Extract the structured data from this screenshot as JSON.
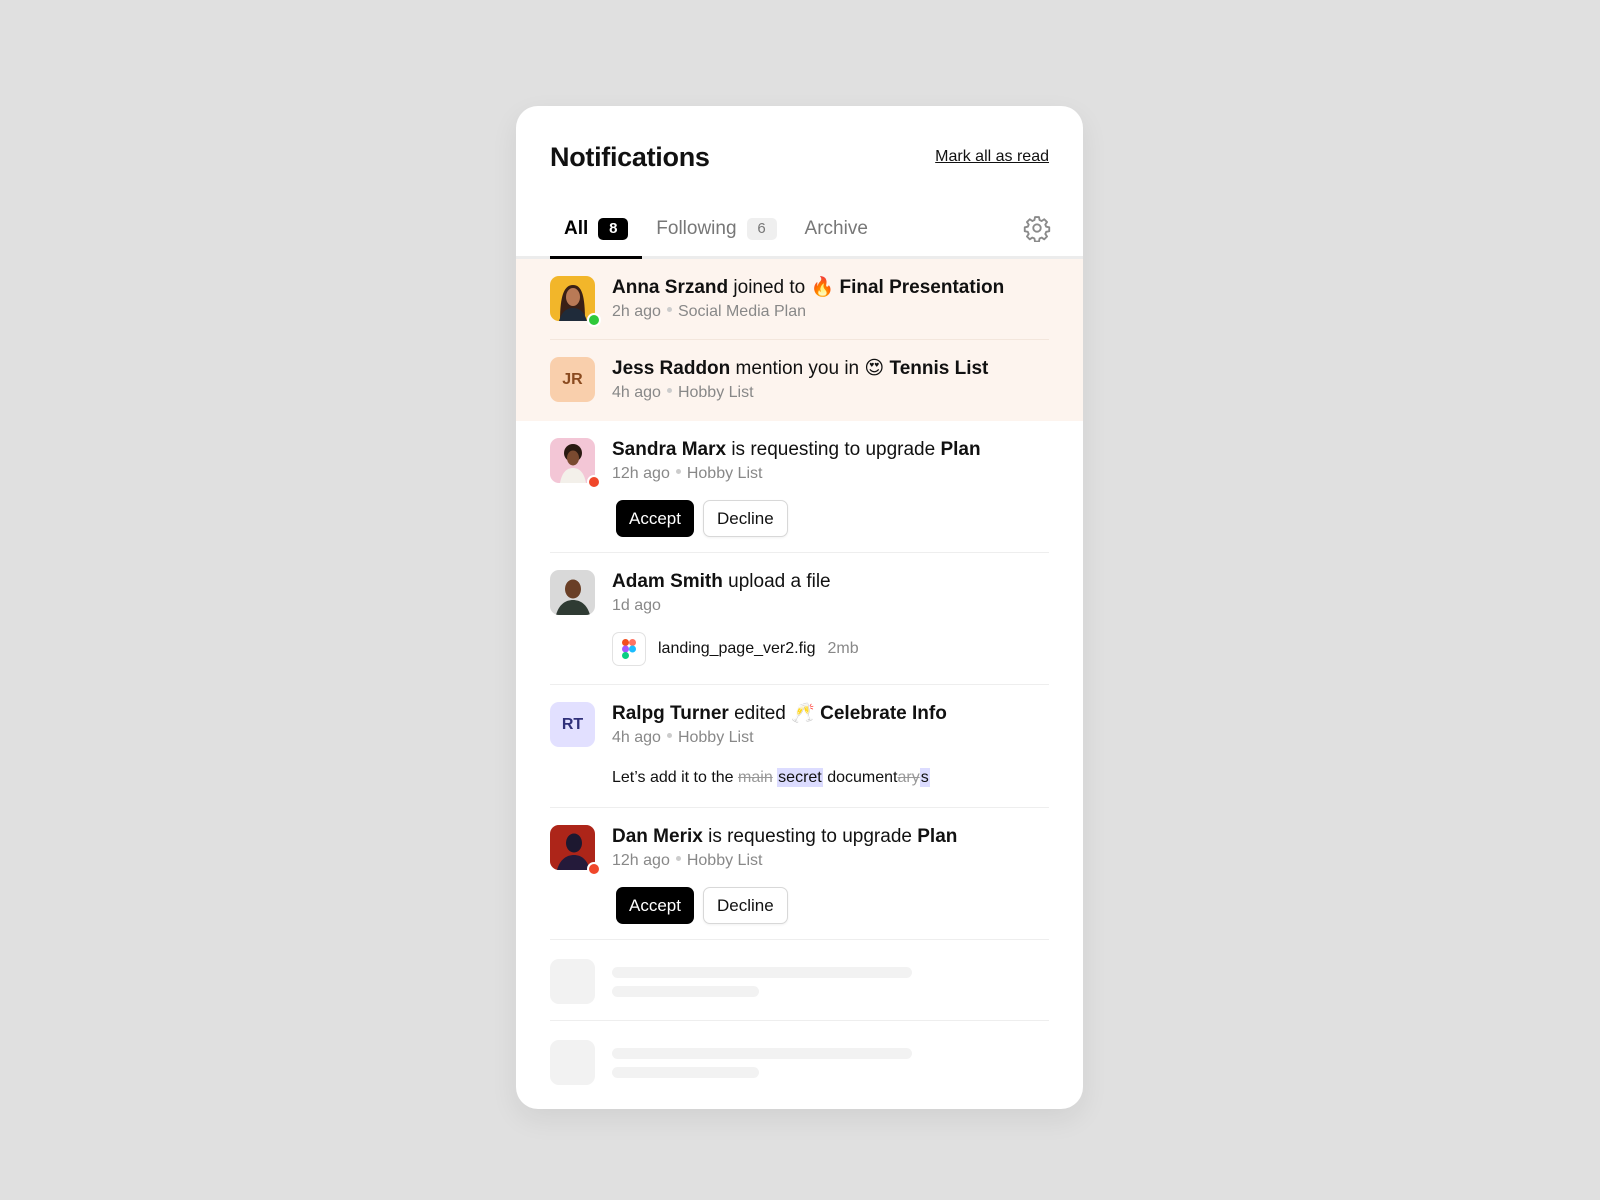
{
  "header": {
    "title": "Notifications",
    "mark_all_read": "Mark all as read"
  },
  "tabs": [
    {
      "label": "All",
      "count": "8"
    },
    {
      "label": "Following",
      "count": "6"
    },
    {
      "label": "Archive"
    }
  ],
  "colors": {
    "online": "#2ec93a",
    "busy": "#f0472a",
    "unread_bg": "#fdf4ee",
    "highlight": "#dcdcff"
  },
  "notifications": [
    {
      "name": "Anna Srzand",
      "action": "joined to",
      "emoji": "🔥",
      "target": "Final Presentation",
      "time": "2h ago",
      "context": "Social Media Plan"
    },
    {
      "name": "Jess Raddon",
      "initials": "JR",
      "action": "mention you in",
      "emoji": "😍",
      "target": "Tennis List",
      "time": "4h ago",
      "context": "Hobby List"
    },
    {
      "name": "Sandra Marx",
      "action": "is requesting to upgrade",
      "target": "Plan",
      "time": "12h ago",
      "context": "Hobby List",
      "accept": "Accept",
      "decline": "Decline"
    },
    {
      "name": "Adam Smith",
      "action": "upload a file",
      "time": "1d ago",
      "file_name": "landing_page_ver2.fig",
      "file_size": "2mb"
    },
    {
      "name": "Ralpg Turner",
      "initials": "RT",
      "action": "edited",
      "emoji": "🥂",
      "target": "Celebrate Info",
      "time": "4h ago",
      "context": "Hobby List",
      "quote": {
        "prefix": "Let’s add it to the",
        "deleted": "main",
        "inserted": "secret",
        "word": "document",
        "deleted2": "ary",
        "inserted2": "s"
      }
    },
    {
      "name": "Dan Merix",
      "action": "is requesting to upgrade",
      "target": "Plan",
      "time": "12h ago",
      "context": "Hobby List",
      "accept": "Accept",
      "decline": "Decline"
    }
  ]
}
